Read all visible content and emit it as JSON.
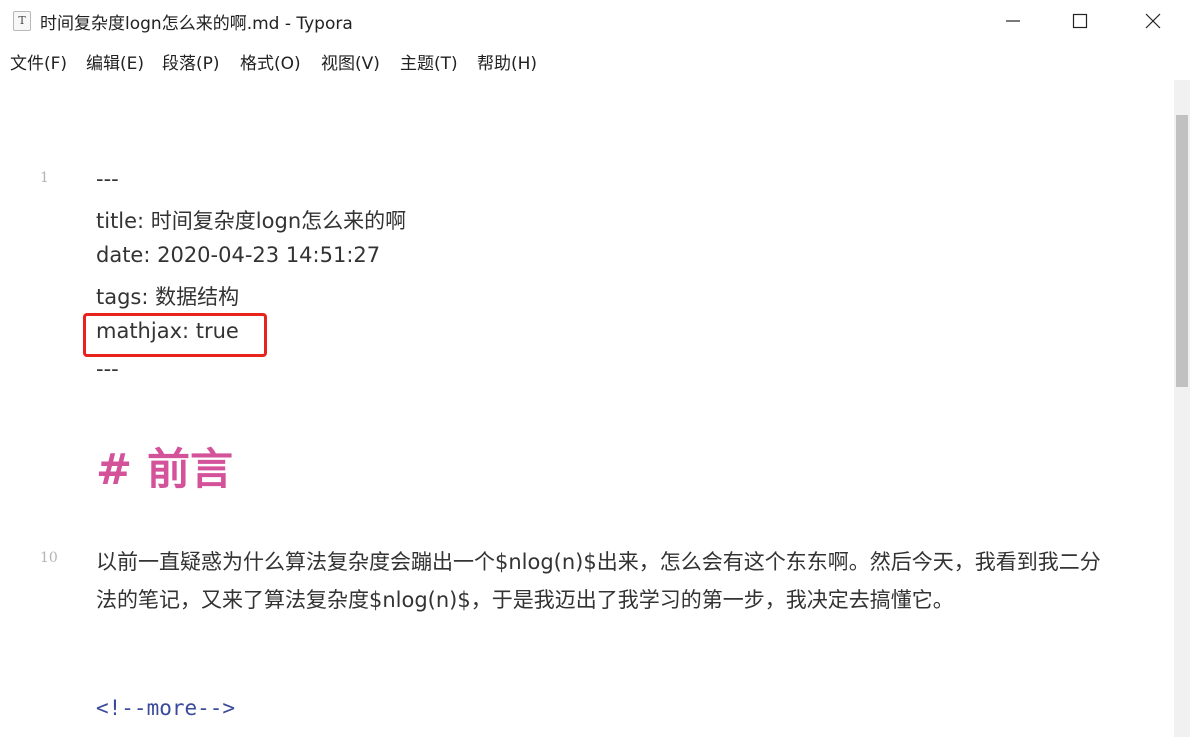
{
  "window": {
    "title": "时间复杂度logn怎么来的啊.md - Typora",
    "app_icon_glyph": "T"
  },
  "menu": [
    {
      "label": "文件(F)"
    },
    {
      "label": "编辑(E)"
    },
    {
      "label": "段落(P)"
    },
    {
      "label": "格式(O)"
    },
    {
      "label": "视图(V)"
    },
    {
      "label": "主题(T)"
    },
    {
      "label": "帮助(H)"
    }
  ],
  "front_matter": {
    "open": "---",
    "title": "title: 时间复杂度logn怎么来的啊",
    "date": "date: 2020-04-23 14:51:27",
    "tags": "tags: 数据结构",
    "mathjax": "mathjax: true",
    "close": "---",
    "line_number": "1"
  },
  "heading": {
    "text": "# 前言"
  },
  "paragraph": {
    "line_number": "10",
    "text": "以前一直疑惑为什么算法复杂度会蹦出一个$nlog(n)$出来，怎么会有这个东东啊。然后今天，我看到我二分法的笔记，又来了算法复杂度$nlog(n)$，于是我迈出了我学习的第一步，我决定去搞懂它。"
  },
  "comment": {
    "text": "<!--more-->"
  },
  "colors": {
    "heading": "#d4529a",
    "highlight_border": "#e8231b",
    "comment": "#3a4a9a"
  }
}
